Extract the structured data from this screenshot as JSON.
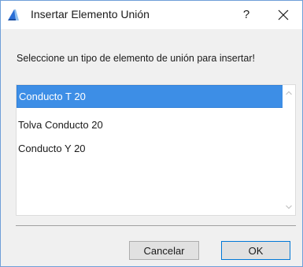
{
  "window": {
    "title": "Insertar Elemento Unión",
    "help_label": "?",
    "app_icon": "archicad-icon",
    "close_icon": "close-icon"
  },
  "prompt": "Seleccione un tipo de elemento de unión para insertar!",
  "list": {
    "items": [
      {
        "label": "Conducto T 20",
        "selected": true
      },
      {
        "label": "Tolva Conducto 20",
        "selected": false
      },
      {
        "label": "Conducto Y 20",
        "selected": false
      }
    ],
    "scroll_up_icon": "chevron-up-icon",
    "scroll_down_icon": "chevron-down-icon"
  },
  "buttons": {
    "cancel_label": "Cancelar",
    "ok_label": "OK"
  },
  "colors": {
    "selection": "#3d8ee6",
    "window_border": "#6f9fd8",
    "default_button_border": "#0078d7"
  }
}
